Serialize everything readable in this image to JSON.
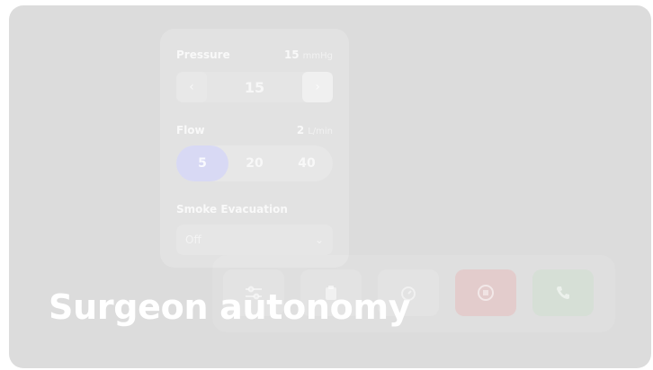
{
  "title": "Surgeon autonomy",
  "pressure": {
    "label": "Pressure",
    "value": "15",
    "unit": "mmHg",
    "stepper_value": "15",
    "dec_icon": "‹",
    "inc_icon": "›"
  },
  "flow": {
    "label": "Flow",
    "value": "2",
    "unit": "L/min",
    "options": [
      "5",
      "20",
      "40"
    ],
    "selected": "5"
  },
  "smoke": {
    "label": "Smoke Evacuation",
    "selected": "Off",
    "chevron": "⌄"
  },
  "dock": {
    "icons": [
      "settings-sliders-icon",
      "clipboard-icon",
      "timer-icon",
      "stop-icon",
      "phone-icon"
    ]
  },
  "colors": {
    "card_bg": "#dcdcdc",
    "active_segment": "#d8d9f4",
    "stop_button": "#e3cccc",
    "phone_button": "#d6dfd6"
  }
}
